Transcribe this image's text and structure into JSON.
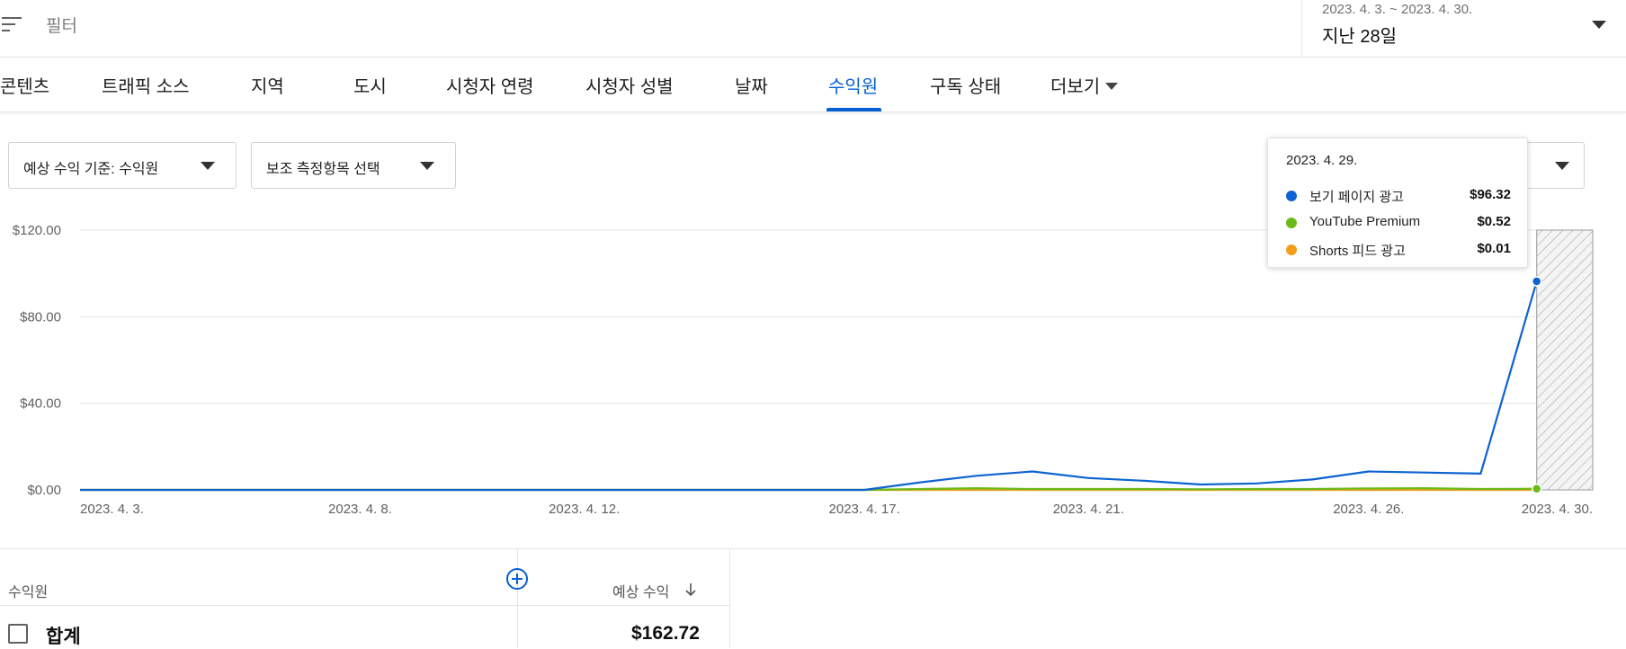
{
  "filter": {
    "label": "필터",
    "icon": "filter-icon"
  },
  "date": {
    "range": "2023. 4. 3. ~ 2023. 4. 30.",
    "preset": "지난 28일"
  },
  "tabs": [
    {
      "label": "콘텐츠"
    },
    {
      "label": "트래픽 소스"
    },
    {
      "label": "지역"
    },
    {
      "label": "도시"
    },
    {
      "label": "시청자 연령"
    },
    {
      "label": "시청자 성별"
    },
    {
      "label": "날짜"
    },
    {
      "label": "수익원",
      "active": true
    },
    {
      "label": "구독 상태"
    },
    {
      "label": "더보기"
    }
  ],
  "dropdowns": {
    "metric": "예상 수익 기준: 수익원",
    "secondary": "보조 측정항목 선택"
  },
  "tooltip": {
    "date": "2023. 4. 29.",
    "rows": [
      {
        "name": "보기 페이지 광고",
        "value": "$96.32",
        "color": "#0d63d1"
      },
      {
        "name": "YouTube Premium",
        "value": "$0.52",
        "color": "#6aba1c"
      },
      {
        "name": "Shorts 피드 광고",
        "value": "$0.01",
        "color": "#f29e1a"
      }
    ]
  },
  "table": {
    "col_source": "수익원",
    "col_revenue": "예상 수익",
    "total_label": "합계",
    "total_value": "$162.72"
  },
  "chart_data": {
    "type": "line",
    "x": [
      "2023-04-03",
      "2023-04-04",
      "2023-04-05",
      "2023-04-06",
      "2023-04-07",
      "2023-04-08",
      "2023-04-09",
      "2023-04-10",
      "2023-04-11",
      "2023-04-12",
      "2023-04-13",
      "2023-04-14",
      "2023-04-15",
      "2023-04-16",
      "2023-04-17",
      "2023-04-18",
      "2023-04-19",
      "2023-04-20",
      "2023-04-21",
      "2023-04-22",
      "2023-04-23",
      "2023-04-24",
      "2023-04-25",
      "2023-04-26",
      "2023-04-27",
      "2023-04-28",
      "2023-04-29"
    ],
    "x_ticks": [
      "2023. 4. 3.",
      "2023. 4. 8.",
      "2023. 4. 12.",
      "2023. 4. 17.",
      "2023. 4. 21.",
      "2023. 4. 26.",
      "2023. 4. 30."
    ],
    "x_tick_dates": [
      "2023-04-03",
      "2023-04-08",
      "2023-04-12",
      "2023-04-17",
      "2023-04-21",
      "2023-04-26",
      "2023-04-30"
    ],
    "x_domain": [
      "2023-04-03",
      "2023-04-30"
    ],
    "y_ticks": [
      "$120.00",
      "$80.00",
      "$40.00",
      "$0.00"
    ],
    "y_tick_values": [
      120,
      80,
      40,
      0
    ],
    "ylim": [
      0,
      120
    ],
    "grid": true,
    "series": [
      {
        "name": "보기 페이지 광고",
        "color": "#0d63d1",
        "values": [
          0,
          0,
          0,
          0,
          0,
          0,
          0,
          0,
          0,
          0,
          0,
          0,
          0,
          0,
          0,
          3.5,
          6.5,
          8.5,
          5.5,
          4.2,
          2.5,
          3,
          4.8,
          8.5,
          8,
          7.5,
          96.32
        ]
      },
      {
        "name": "YouTube Premium",
        "color": "#6aba1c",
        "values": [
          0,
          0,
          0,
          0,
          0,
          0,
          0,
          0,
          0,
          0,
          0,
          0,
          0,
          0,
          0,
          0.4,
          0.8,
          0.4,
          0.4,
          0.4,
          0.3,
          0.4,
          0.4,
          0.7,
          0.8,
          0.4,
          0.52
        ]
      },
      {
        "name": "Shorts 피드 광고",
        "color": "#f29e1a",
        "values": [
          0,
          0,
          0,
          0,
          0,
          0,
          0,
          0,
          0,
          0,
          0,
          0,
          0,
          0,
          0,
          0,
          0,
          0,
          0,
          0,
          0,
          0,
          0,
          0,
          0,
          0,
          0.01
        ]
      }
    ]
  }
}
